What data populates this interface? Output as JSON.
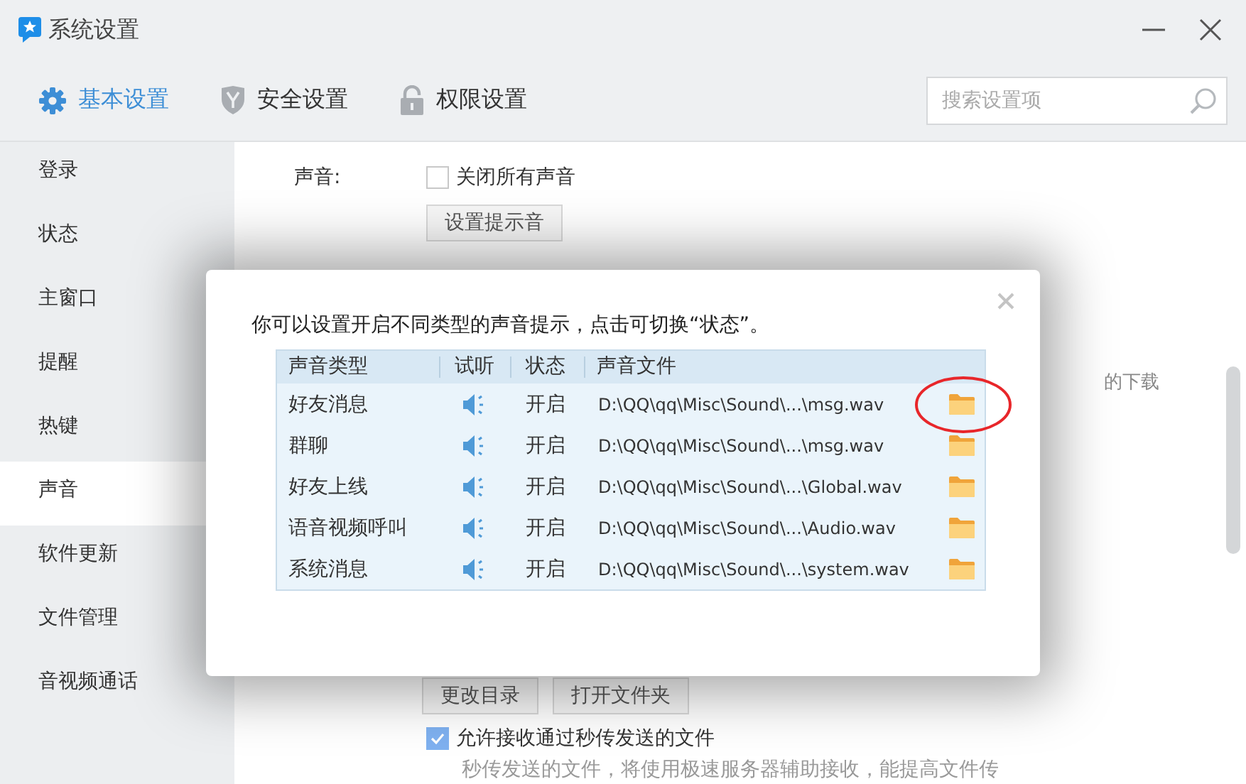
{
  "window": {
    "title": "系统设置"
  },
  "tabs": [
    {
      "label": "基本设置",
      "selected": true
    },
    {
      "label": "安全设置",
      "selected": false
    },
    {
      "label": "权限设置",
      "selected": false
    }
  ],
  "search": {
    "placeholder": "搜索设置项"
  },
  "sidebar": {
    "items": [
      {
        "label": "登录",
        "selected": false
      },
      {
        "label": "状态",
        "selected": false
      },
      {
        "label": "主窗口",
        "selected": false
      },
      {
        "label": "提醒",
        "selected": false
      },
      {
        "label": "热键",
        "selected": false
      },
      {
        "label": "声音",
        "selected": true
      },
      {
        "label": "软件更新",
        "selected": false
      },
      {
        "label": "文件管理",
        "selected": false
      },
      {
        "label": "音视频通话",
        "selected": false
      }
    ]
  },
  "settings": {
    "sound_label": "声音:",
    "mute_all": {
      "label": "关闭所有声音",
      "checked": false
    },
    "set_sound_button": "设置提示音",
    "partial_text": "的下载",
    "folder_buttons": [
      "更改目录",
      "打开文件夹"
    ],
    "allow_quick_send": {
      "label": "允许接收通过秒传发送的文件",
      "checked": true
    },
    "quick_send_note": "秒传发送的文件，将使用极速服务器辅助接收，能提高文件传"
  },
  "dialog": {
    "message": "你可以设置开启不同类型的声音提示，点击可切换“状态”。",
    "columns": [
      "声音类型",
      "试听",
      "状态",
      "声音文件"
    ],
    "rows": [
      {
        "type": "好友消息",
        "status": "开启",
        "file": "D:\\QQ\\qq\\Misc\\Sound\\...\\msg.wav",
        "circled": true
      },
      {
        "type": "群聊",
        "status": "开启",
        "file": "D:\\QQ\\qq\\Misc\\Sound\\...\\msg.wav",
        "circled": false
      },
      {
        "type": "好友上线",
        "status": "开启",
        "file": "D:\\QQ\\qq\\Misc\\Sound\\...\\Global.wav",
        "circled": false
      },
      {
        "type": "语音视频呼叫",
        "status": "开启",
        "file": "D:\\QQ\\qq\\Misc\\Sound\\...\\Audio.wav",
        "circled": false
      },
      {
        "type": "系统消息",
        "status": "开启",
        "file": "D:\\QQ\\qq\\Misc\\Sound\\...\\system.wav",
        "circled": false
      }
    ]
  }
}
